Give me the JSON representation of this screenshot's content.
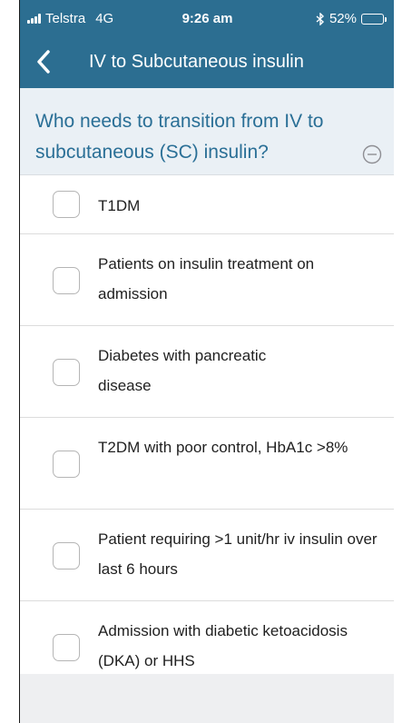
{
  "status_bar": {
    "carrier": "Telstra",
    "network": "4G",
    "time": "9:26 am",
    "bluetooth_icon": "bluetooth-icon",
    "battery_percent": "52%",
    "battery_level": 0.52
  },
  "nav": {
    "title": "IV to Subcutaneous insulin",
    "back_icon": "chevron-left-icon"
  },
  "question": {
    "text": "Who needs to transition from IV to subcutaneous (SC) insulin?",
    "collapse_icon": "minus-circle-icon"
  },
  "items": [
    {
      "label": "T1DM",
      "checked": false
    },
    {
      "label": "Patients on insulin treatment on admission",
      "checked": false
    },
    {
      "label": "Diabetes with pancreatic disease",
      "checked": false
    },
    {
      "label": "T2DM with poor control, HbA1c >8%",
      "checked": false
    },
    {
      "label": "Patient requiring >1 unit/hr iv insulin over last 6 hours",
      "checked": false
    },
    {
      "label": "Admission with diabetic ketoacidosis (DKA) or HHS",
      "checked": false
    }
  ],
  "colors": {
    "header": "#2c6e91",
    "question_bg": "#eaf0f5",
    "question_text": "#2a6f96",
    "battery": "#4cd964"
  }
}
